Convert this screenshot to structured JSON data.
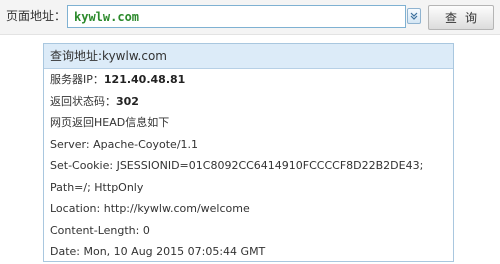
{
  "toolbar": {
    "url_label": "页面地址：",
    "url_value": "kywlw.com",
    "search_label": "查询"
  },
  "panel": {
    "title": "查询地址:kywlw.com",
    "server_ip_label": "服务器IP：",
    "server_ip_value": "121.40.48.81",
    "status_label": "返回状态码：",
    "status_value": "302",
    "headers_intro": "网页返回HEAD信息如下",
    "header_lines": [
      "Server: Apache-Coyote/1.1",
      "Set-Cookie: JSESSIONID=01C8092CC6414910FCCCCF8D22B2DE43;",
      "Path=/; HttpOnly",
      "Location: http://kywlw.com/welcome",
      "Content-Length: 0",
      "Date: Mon, 10 Aug 2015 07:05:44 GMT"
    ]
  },
  "icons": {
    "dropdown": "chevron-down-icon"
  },
  "colors": {
    "url_text": "#2c8a2c",
    "panel_header_bg": "#dcebf8",
    "panel_border": "#a9c7df"
  }
}
